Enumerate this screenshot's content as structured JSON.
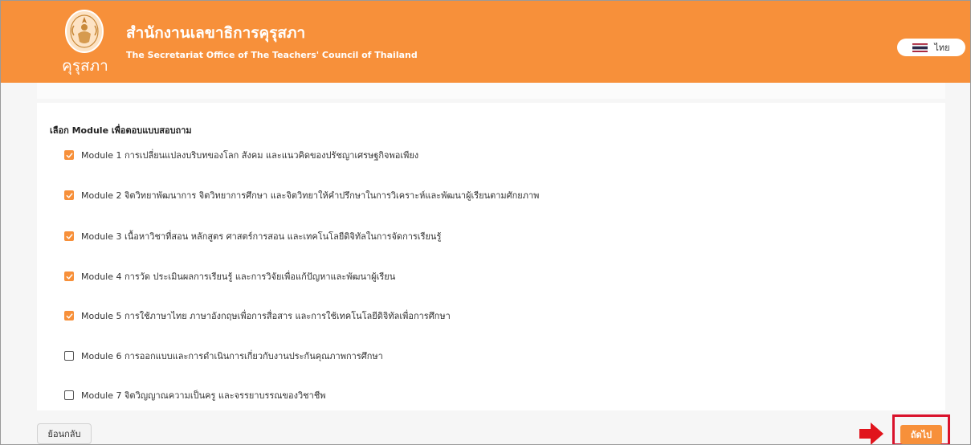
{
  "header": {
    "logo_text": "คุรุสภา",
    "title": "สำนักงานเลขาธิการคุรุสภา",
    "subtitle": "The Secretariat Office of The Teachers' Council of Thailand",
    "language_label": "ไทย"
  },
  "questionnaire": {
    "section_title": "เลือก Module เพื่อตอบแบบสอบถาม",
    "modules": [
      {
        "label": "Module 1 การเปลี่ยนแปลงบริบทของโลก สังคม และแนวคิดของปรัชญาเศรษฐกิจพอเพียง",
        "checked": true
      },
      {
        "label": "Module 2 จิตวิทยาพัฒนาการ จิตวิทยาการศึกษา และจิตวิทยาให้คำปรึกษาในการวิเคราะห์และพัฒนาผู้เรียนตามศักยภาพ",
        "checked": true
      },
      {
        "label": "Module 3 เนื้อหาวิชาที่สอน หลักสูตร ศาสตร์การสอน และเทคโนโลยีดิจิทัลในการจัดการเรียนรู้",
        "checked": true
      },
      {
        "label": "Module 4 การวัด ประเมินผลการเรียนรู้ และการวิจัยเพื่อแก้ปัญหาและพัฒนาผู้เรียน",
        "checked": true
      },
      {
        "label": "Module 5 การใช้ภาษาไทย ภาษาอังกฤษเพื่อการสื่อสาร และการใช้เทคโนโลยีดิจิทัลเพื่อการศึกษา",
        "checked": true
      },
      {
        "label": "Module 6 การออกแบบและการดำเนินการเกี่ยวกับงานประกันคุณภาพการศึกษา",
        "checked": false
      },
      {
        "label": "Module 7 จิตวิญญาณความเป็นครู และจรรยาบรรณของวิชาชีพ",
        "checked": false
      }
    ]
  },
  "actions": {
    "back_label": "ย้อนกลับ",
    "next_label": "ถัดไป"
  },
  "colors": {
    "brand_orange": "#f7903a",
    "highlight_red": "#d9122b"
  },
  "icons": {
    "logo": "teachers-council-emblem-icon",
    "flag": "thai-flag-icon",
    "checkbox_checked": "check-icon",
    "annotation": "arrow-right-icon"
  }
}
